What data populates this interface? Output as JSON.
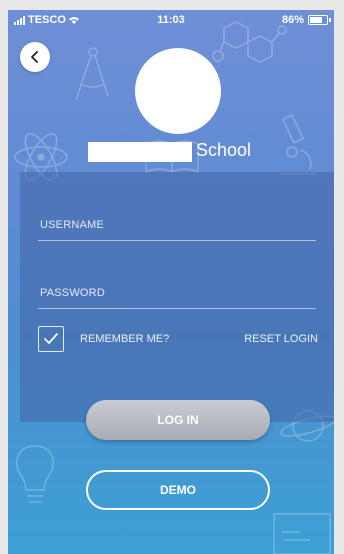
{
  "status_bar": {
    "carrier": "TESCO",
    "time": "11:03",
    "battery": "86%",
    "battery_level": 0.86
  },
  "header": {
    "back_icon": "chevron-left-icon",
    "school_suffix": "School"
  },
  "form": {
    "username_placeholder": "USERNAME",
    "password_placeholder": "PASSWORD",
    "remember_label": "REMEMBER ME?",
    "remember_checked": true,
    "reset_label": "RESET LOGIN"
  },
  "actions": {
    "login_label": "LOG IN",
    "demo_label": "DEMO"
  },
  "colors": {
    "gradient_top": "#6f8fd6",
    "gradient_bottom": "#3da0d5",
    "login_button": "#b8bcc5"
  }
}
